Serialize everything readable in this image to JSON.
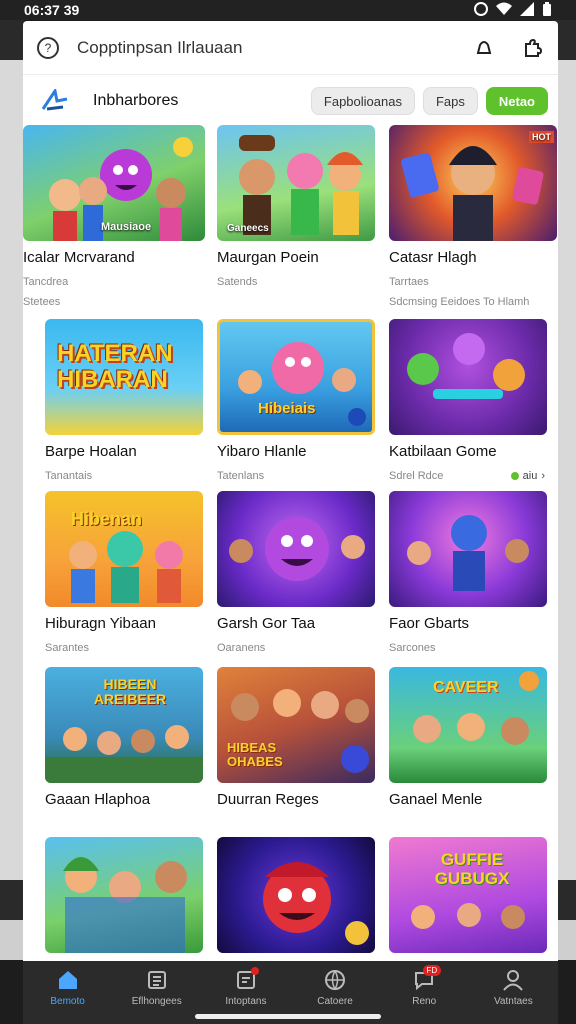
{
  "status": {
    "time": "06:37 39"
  },
  "search": {
    "text": "Copptinpsan Ilrlauaan"
  },
  "filter": {
    "title": "Inbharbores",
    "chips": [
      "Fapbolioanas",
      "Faps",
      "Netao"
    ]
  },
  "cards": [
    {
      "title": "Icalar Mcrvarand",
      "meta": "Tancdrea",
      "sub": "Stetees",
      "banner": "Mausiaoe"
    },
    {
      "title": "Maurgan Poein",
      "meta": "Satends",
      "sub": "",
      "banner": "Ganeecs"
    },
    {
      "title": "Catasr Hlagh",
      "meta": "Tarrtaes",
      "sub": "Sdcmsing Eeidoes To Hlamh",
      "banner": ""
    },
    {
      "title": "Barpe Hoalan",
      "meta": "Tanantais",
      "sub": "",
      "banner": "HATERAN HIBARAN"
    },
    {
      "title": "Yibaro Hlanle",
      "meta": "Tatenlans",
      "sub": "",
      "banner": "Hibeiais"
    },
    {
      "title": "Katbilaan Gome",
      "meta": "Sdrel Rdce",
      "sub": "",
      "banner": "",
      "indicator": "aiu"
    },
    {
      "title": "Hiburagn Yibaan",
      "meta": "Sarantes",
      "sub": "",
      "banner": "Hibenan"
    },
    {
      "title": "Garsh Gor Taa",
      "meta": "Oaranens",
      "sub": "",
      "banner": ""
    },
    {
      "title": "Faor Gbarts",
      "meta": "Sarcones",
      "sub": "",
      "banner": ""
    },
    {
      "title": "Gaaan Hlaphoa",
      "meta": "",
      "sub": "",
      "banner": "HIBEEN AREIBEER"
    },
    {
      "title": "Duurran Reges",
      "meta": "",
      "sub": "",
      "banner": "HIBEAS OHABES"
    },
    {
      "title": "Ganael Menle",
      "meta": "",
      "sub": "",
      "banner": "CAVEER"
    },
    {
      "title": "",
      "meta": "",
      "sub": "",
      "banner": ""
    },
    {
      "title": "",
      "meta": "",
      "sub": "",
      "banner": ""
    },
    {
      "title": "",
      "meta": "",
      "sub": "",
      "banner": "GUFFIE GUBUGX"
    }
  ],
  "nav": [
    {
      "label": "Bemoto",
      "icon": "home-icon",
      "active": true
    },
    {
      "label": "Eflhongees",
      "icon": "list-icon"
    },
    {
      "label": "Intoptans",
      "icon": "inbox-icon",
      "badge": ""
    },
    {
      "label": "Catoere",
      "icon": "globe-icon"
    },
    {
      "label": "Reno",
      "icon": "chat-icon",
      "badge": "FD"
    },
    {
      "label": "Vatntaes",
      "icon": "user-icon"
    }
  ],
  "colors": {
    "accent": "#5fc22c",
    "nav_active": "#4aa6ff",
    "nav_bg": "#2b2b2b",
    "badge": "#e02020"
  }
}
